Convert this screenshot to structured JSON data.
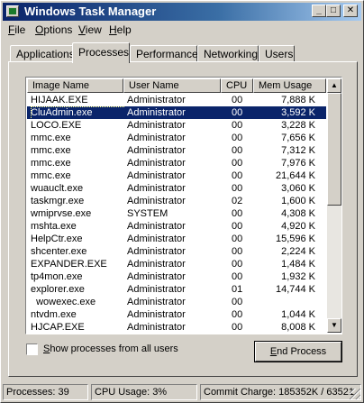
{
  "window": {
    "title": "Windows Task Manager",
    "controls": {
      "minimize": "_",
      "maximize": "□",
      "close": "✕"
    }
  },
  "menu": [
    {
      "first": "F",
      "rest": "ile"
    },
    {
      "first": "O",
      "rest": "ptions"
    },
    {
      "first": "V",
      "rest": "iew"
    },
    {
      "first": "H",
      "rest": "elp"
    }
  ],
  "tabs": [
    "Applications",
    "Processes",
    "Performance",
    "Networking",
    "Users"
  ],
  "active_tab": "Processes",
  "table": {
    "columns": [
      "Image Name",
      "User Name",
      "CPU",
      "Mem Usage"
    ],
    "rows": [
      {
        "name": "HIJAAK.EXE",
        "user": "Administrator",
        "cpu": "00",
        "mem": "7,888 K"
      },
      {
        "name": "CluAdmin.exe",
        "user": "Administrator",
        "cpu": "00",
        "mem": "3,592 K",
        "selected": true
      },
      {
        "name": "LOCO.EXE",
        "user": "Administrator",
        "cpu": "00",
        "mem": "3,228 K"
      },
      {
        "name": "mmc.exe",
        "user": "Administrator",
        "cpu": "00",
        "mem": "7,656 K"
      },
      {
        "name": "mmc.exe",
        "user": "Administrator",
        "cpu": "00",
        "mem": "7,312 K"
      },
      {
        "name": "mmc.exe",
        "user": "Administrator",
        "cpu": "00",
        "mem": "7,976 K"
      },
      {
        "name": "mmc.exe",
        "user": "Administrator",
        "cpu": "00",
        "mem": "21,644 K"
      },
      {
        "name": "wuauclt.exe",
        "user": "Administrator",
        "cpu": "00",
        "mem": "3,060 K"
      },
      {
        "name": "taskmgr.exe",
        "user": "Administrator",
        "cpu": "02",
        "mem": "1,600 K"
      },
      {
        "name": "wmiprvse.exe",
        "user": "SYSTEM",
        "cpu": "00",
        "mem": "4,308 K"
      },
      {
        "name": "mshta.exe",
        "user": "Administrator",
        "cpu": "00",
        "mem": "4,920 K"
      },
      {
        "name": "HelpCtr.exe",
        "user": "Administrator",
        "cpu": "00",
        "mem": "15,596 K"
      },
      {
        "name": "shcenter.exe",
        "user": "Administrator",
        "cpu": "00",
        "mem": "2,224 K"
      },
      {
        "name": "EXPANDER.EXE",
        "user": "Administrator",
        "cpu": "00",
        "mem": "1,484 K"
      },
      {
        "name": "tp4mon.exe",
        "user": "Administrator",
        "cpu": "00",
        "mem": "1,932 K"
      },
      {
        "name": "explorer.exe",
        "user": "Administrator",
        "cpu": "01",
        "mem": "14,744 K"
      },
      {
        "name": "  wowexec.exe",
        "user": "Administrator",
        "cpu": "00",
        "mem": ""
      },
      {
        "name": "ntvdm.exe",
        "user": "Administrator",
        "cpu": "00",
        "mem": "1,044 K"
      },
      {
        "name": "HJCAP.EXE",
        "user": "Administrator",
        "cpu": "00",
        "mem": "8,008 K"
      }
    ]
  },
  "show_all_label_first": "S",
  "show_all_label_rest": "how processes from all users",
  "show_all_checked": false,
  "end_process_first": "E",
  "end_process_rest": "nd Process",
  "status": {
    "processes": "Processes: 39",
    "cpu": "CPU Usage: 3%",
    "commit": "Commit Charge: 185352K / 63521"
  }
}
